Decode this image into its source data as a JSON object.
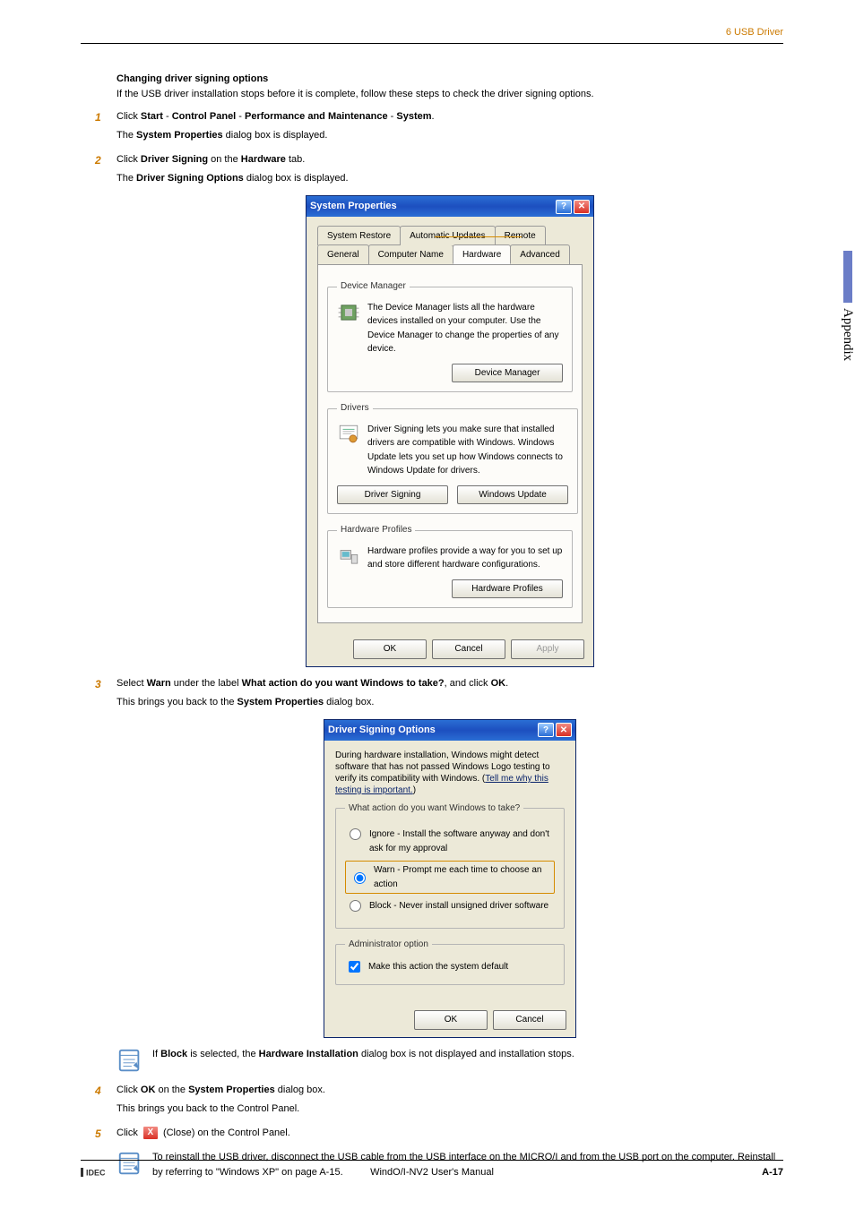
{
  "header": {
    "right": "6 USB Driver"
  },
  "sidetab": "Appendix",
  "intro": {
    "heading": "Changing driver signing options",
    "desc": "If the USB driver installation stops before it is complete, follow these steps to check the driver signing options."
  },
  "steps": {
    "s1": {
      "a": "Click ",
      "b1": "Start",
      "dash": " - ",
      "b2": "Control Panel",
      "b3": "Performance and Maintenance",
      "b4": "System",
      "end": ".",
      "p": "The ",
      "pb": "System Properties",
      "p2": " dialog box is displayed."
    },
    "s2": {
      "a": "Click ",
      "b1": "Driver Signing",
      "mid": " on the ",
      "b2": "Hardware",
      "end": " tab.",
      "p": "The ",
      "pb": "Driver Signing Options",
      "p2": " dialog box is displayed."
    },
    "s3": {
      "a": "Select ",
      "b1": "Warn",
      "mid": " under the label ",
      "b2": "What action do you want Windows to take?",
      "c": ", and click ",
      "b3": "OK",
      "end": ".",
      "p": "This brings you back to the ",
      "pb": "System Properties",
      "p2": " dialog box."
    },
    "note1": {
      "a": "If ",
      "b1": "Block",
      "mid": " is selected, the ",
      "b2": "Hardware Installation",
      "end": " dialog box is not displayed and installation stops."
    },
    "s4": {
      "a": "Click ",
      "b1": "OK",
      "mid": " on the ",
      "b2": "System Properties",
      "end": " dialog box.",
      "p": "This brings you back to the Control Panel."
    },
    "s5": {
      "a": "Click ",
      "closeX": "X",
      "b": " (Close) on the Control Panel."
    },
    "note2": "To reinstall the USB driver, disconnect the USB cable from the USB interface on the MICRO/I and from the USB port on the computer. Reinstall by referring to \"Windows XP\" on page A-15."
  },
  "sysprops": {
    "title": "System Properties",
    "tabs_top": [
      "System Restore",
      "Automatic Updates",
      "Remote"
    ],
    "tabs_bot": [
      "General",
      "Computer Name",
      "Hardware",
      "Advanced"
    ],
    "devmgr": {
      "legend": "Device Manager",
      "desc": "The Device Manager lists all the hardware devices installed on your computer. Use the Device Manager to change the properties of any device.",
      "btn": "Device Manager"
    },
    "drivers": {
      "legend": "Drivers",
      "desc": "Driver Signing lets you make sure that installed drivers are compatible with Windows. Windows Update lets you set up how Windows connects to Windows Update for drivers.",
      "btn1": "Driver Signing",
      "btn2": "Windows Update"
    },
    "hwprof": {
      "legend": "Hardware Profiles",
      "desc": "Hardware profiles provide a way for you to set up and store different hardware configurations.",
      "btn": "Hardware Profiles"
    },
    "ok": "OK",
    "cancel": "Cancel",
    "apply": "Apply"
  },
  "dso": {
    "title": "Driver Signing Options",
    "desc1": "During hardware installation, Windows might detect software that has not passed Windows Logo testing to verify its compatibility with Windows. (",
    "link": "Tell me why this testing is important.",
    "desc2": ")",
    "grp1_legend": "What action do you want Windows to take?",
    "opt_ignore": "Ignore - Install the software anyway and don't ask for my approval",
    "opt_warn": "Warn - Prompt me each time to choose an action",
    "opt_block": "Block - Never install unsigned driver software",
    "grp2_legend": "Administrator option",
    "chk": "Make this action the system default",
    "ok": "OK",
    "cancel": "Cancel"
  },
  "footer": {
    "center": "WindO/I-NV2 User's Manual",
    "page": "A-17"
  }
}
